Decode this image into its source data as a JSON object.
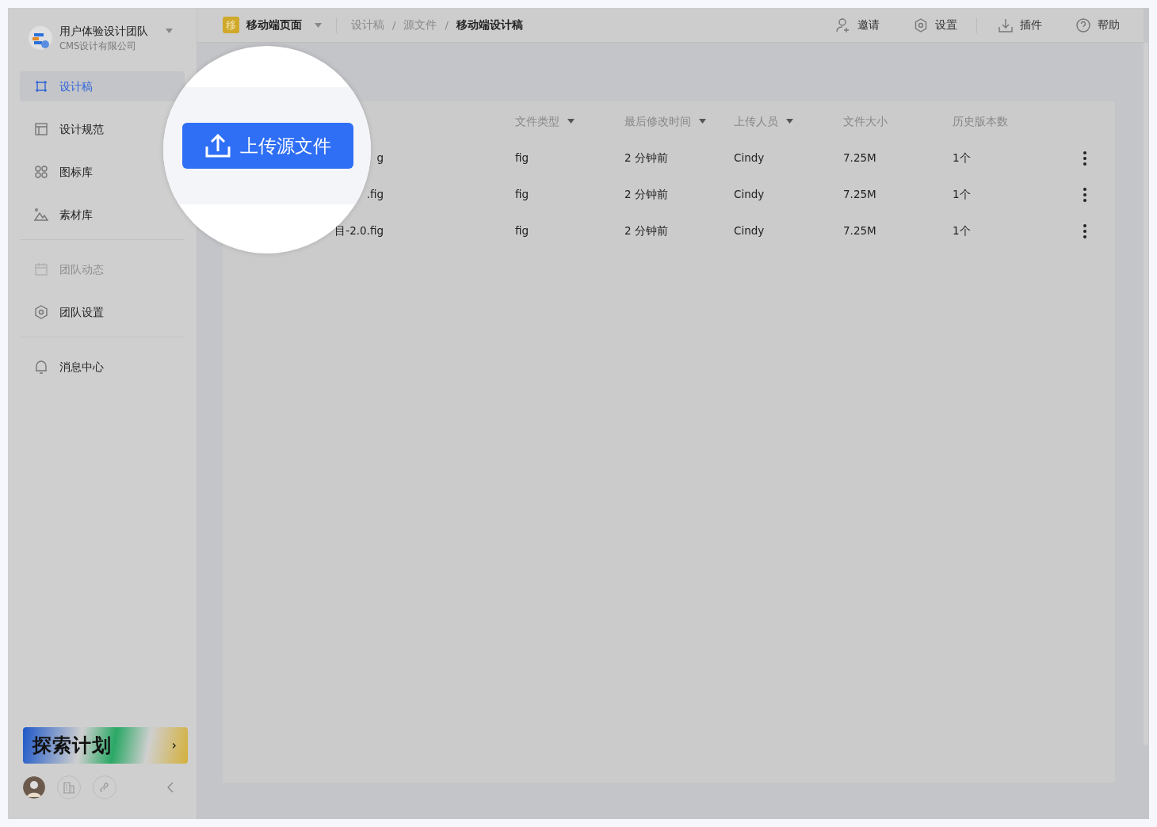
{
  "team": {
    "name": "用户体验设计团队",
    "company": "CMS设计有限公司"
  },
  "nav_groups": [
    {
      "items": [
        {
          "label": "设计稿",
          "selected": true,
          "disabled": false
        },
        {
          "label": "设计规范",
          "selected": false,
          "disabled": false
        },
        {
          "label": "图标库",
          "selected": false,
          "disabled": false
        },
        {
          "label": "素材库",
          "selected": false,
          "disabled": false
        }
      ]
    },
    {
      "items": [
        {
          "label": "团队动态",
          "selected": false,
          "disabled": true
        },
        {
          "label": "团队设置",
          "selected": false,
          "disabled": false
        }
      ]
    },
    {
      "items": [
        {
          "label": "消息中心",
          "selected": false,
          "disabled": false
        }
      ]
    }
  ],
  "promo": {
    "title": "探索计划",
    "arrow": "›"
  },
  "project": {
    "badge": "移",
    "name": "移动端页面"
  },
  "breadcrumb": [
    "设计稿",
    "源文件",
    "移动端设计稿"
  ],
  "breadcrumb_separator": "/",
  "actions": [
    {
      "label": "邀请"
    },
    {
      "label": "设置"
    },
    {
      "label": "插件"
    },
    {
      "label": "帮助"
    }
  ],
  "table": {
    "columns": [
      {
        "label": "文件类型",
        "sortable": true
      },
      {
        "label": "最后修改时间",
        "sortable": true
      },
      {
        "label": "上传人员",
        "sortable": true
      },
      {
        "label": "文件大小",
        "sortable": false
      },
      {
        "label": "历史版本数",
        "sortable": false
      }
    ],
    "rows": [
      {
        "name": "g",
        "type": "fig",
        "time": "2 分钟前",
        "uploader": "Cindy",
        "size": "7.25M",
        "versions": "1个"
      },
      {
        "name": ".fig",
        "type": "fig",
        "time": "2 分钟前",
        "uploader": "Cindy",
        "size": "7.25M",
        "versions": "1个"
      },
      {
        "name": "目-2.0.fig",
        "type": "fig",
        "time": "2 分钟前",
        "uploader": "Cindy",
        "size": "7.25M",
        "versions": "1个"
      }
    ]
  },
  "upload_button": {
    "label": "上传源文件"
  }
}
